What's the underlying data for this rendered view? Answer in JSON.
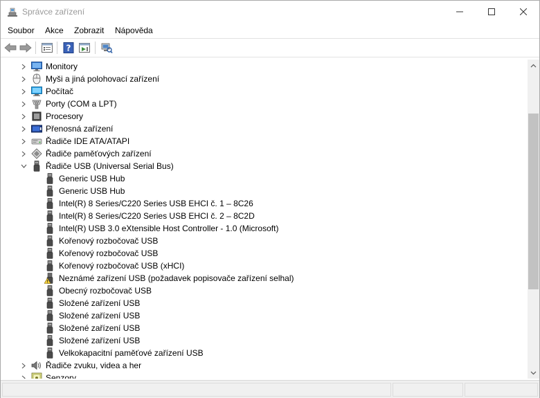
{
  "window": {
    "title": "Správce zařízení"
  },
  "menu": [
    "Soubor",
    "Akce",
    "Zobrazit",
    "Nápověda"
  ],
  "toolbar": {
    "icons": [
      "back-icon",
      "forward-icon",
      "properties-view-icon",
      "help-icon",
      "action-view-icon",
      "scan-hardware-icon"
    ]
  },
  "tree": [
    {
      "label": "Monitory",
      "level": 0,
      "expander": "collapsed",
      "icon": "monitor-icon"
    },
    {
      "label": "Myši a jiná polohovací zařízení",
      "level": 0,
      "expander": "collapsed",
      "icon": "mouse-icon"
    },
    {
      "label": "Počítač",
      "level": 0,
      "expander": "collapsed",
      "icon": "computer-icon"
    },
    {
      "label": "Porty (COM a LPT)",
      "level": 0,
      "expander": "collapsed",
      "icon": "port-icon"
    },
    {
      "label": "Procesory",
      "level": 0,
      "expander": "collapsed",
      "icon": "processor-icon"
    },
    {
      "label": "Přenosná zařízení",
      "level": 0,
      "expander": "collapsed",
      "icon": "portable-device-icon"
    },
    {
      "label": "Řadiče IDE ATA/ATAPI",
      "level": 0,
      "expander": "collapsed",
      "icon": "ide-controller-icon"
    },
    {
      "label": "Řadiče paměťových zařízení",
      "level": 0,
      "expander": "collapsed",
      "icon": "storage-controller-icon"
    },
    {
      "label": "Řadiče USB (Universal Serial Bus)",
      "level": 0,
      "expander": "expanded",
      "icon": "usb-icon"
    },
    {
      "label": "Generic USB Hub",
      "level": 1,
      "icon": "usb-icon"
    },
    {
      "label": "Generic USB Hub",
      "level": 1,
      "icon": "usb-icon"
    },
    {
      "label": "Intel(R) 8 Series/C220 Series USB EHCI č. 1 – 8C26",
      "level": 1,
      "icon": "usb-icon"
    },
    {
      "label": "Intel(R) 8 Series/C220 Series USB EHCI č. 2 – 8C2D",
      "level": 1,
      "icon": "usb-icon"
    },
    {
      "label": "Intel(R) USB 3.0 eXtensible Host Controller - 1.0 (Microsoft)",
      "level": 1,
      "icon": "usb-icon"
    },
    {
      "label": "Kořenový rozbočovač USB",
      "level": 1,
      "icon": "usb-icon"
    },
    {
      "label": "Kořenový rozbočovač USB",
      "level": 1,
      "icon": "usb-icon"
    },
    {
      "label": "Kořenový rozbočovač USB (xHCI)",
      "level": 1,
      "icon": "usb-icon"
    },
    {
      "label": "Neznámé zařízení USB (požadavek popisovače zařízení selhal)",
      "level": 1,
      "icon": "usb-warning-icon"
    },
    {
      "label": "Obecný rozbočovač USB",
      "level": 1,
      "icon": "usb-icon"
    },
    {
      "label": "Složené zařízení USB",
      "level": 1,
      "icon": "usb-icon"
    },
    {
      "label": "Složené zařízení USB",
      "level": 1,
      "icon": "usb-icon"
    },
    {
      "label": "Složené zařízení USB",
      "level": 1,
      "icon": "usb-icon"
    },
    {
      "label": "Složené zařízení USB",
      "level": 1,
      "icon": "usb-icon"
    },
    {
      "label": "Velkokapacitní paměťové zařízení USB",
      "level": 1,
      "icon": "usb-icon"
    },
    {
      "label": "Řadiče zvuku, videa a her",
      "level": 0,
      "expander": "collapsed",
      "icon": "sound-icon"
    },
    {
      "label": "Senzory",
      "level": 0,
      "expander": "collapsed",
      "icon": "sensor-icon"
    }
  ]
}
